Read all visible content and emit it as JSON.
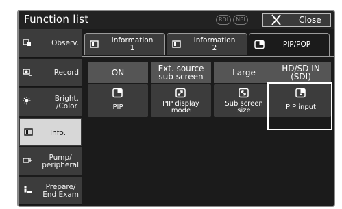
{
  "window": {
    "title": "Function list",
    "mode_badges": [
      "RDI",
      "NBI"
    ],
    "close_label": "Close"
  },
  "sidebar": {
    "items": [
      {
        "label": "Observ.",
        "icon": "observe-icon",
        "active": false
      },
      {
        "label": "Record",
        "icon": "camera-record-icon",
        "active": false
      },
      {
        "label": "Bright.\n/Color",
        "icon": "brightness-icon",
        "active": false
      },
      {
        "label": "Info.",
        "icon": "monitor-icon",
        "active": true
      },
      {
        "label": "Pump/\nperipheral",
        "icon": "pump-icon",
        "active": false
      },
      {
        "label": "Prepare/\nEnd Exam",
        "icon": "prepare-icon",
        "active": false
      }
    ]
  },
  "tabs": [
    {
      "label": "Information\n1",
      "icon": "monitor-icon",
      "active": false
    },
    {
      "label": "Information\n2",
      "icon": "monitor-icon",
      "active": false
    },
    {
      "label": "PIP/POP",
      "icon": "pip-icon",
      "active": true
    }
  ],
  "functions": [
    {
      "status": "ON",
      "label": "PIP",
      "icon": "pip-icon"
    },
    {
      "status": "Ext. source\nsub screen",
      "label": "PIP display\nmode",
      "icon": "pip-display-mode-icon"
    },
    {
      "status": "Large",
      "label": "Sub screen\nsize",
      "icon": "sub-screen-size-icon"
    },
    {
      "status": "HD/SD IN\n(SDI)",
      "label": "PIP input",
      "icon": "pip-input-icon"
    }
  ]
}
